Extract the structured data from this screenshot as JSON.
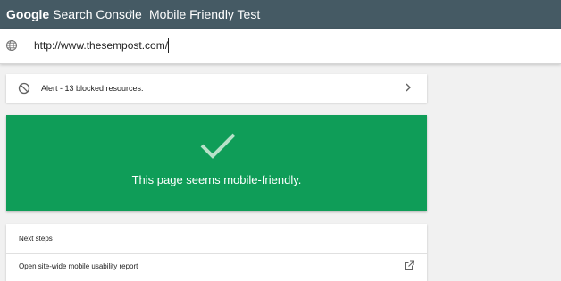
{
  "header": {
    "brand_google": "Google",
    "brand_product": "Search Console",
    "separator": "›",
    "title": "Mobile Friendly Test",
    "background_color": "#455a64"
  },
  "url_bar": {
    "value": "http://www.thesempost.com/",
    "icon": "globe-icon"
  },
  "alert": {
    "icon": "blocked-icon",
    "text": "Alert - 13 blocked resources.",
    "action_icon": "chevron-right-icon"
  },
  "result": {
    "icon": "check-icon",
    "text": "This page seems mobile-friendly.",
    "background_color": "#0f9d58"
  },
  "next_steps": {
    "title": "Next steps",
    "items": [
      {
        "label": "Open site-wide mobile usability report",
        "icon": "open-external-icon"
      }
    ]
  }
}
